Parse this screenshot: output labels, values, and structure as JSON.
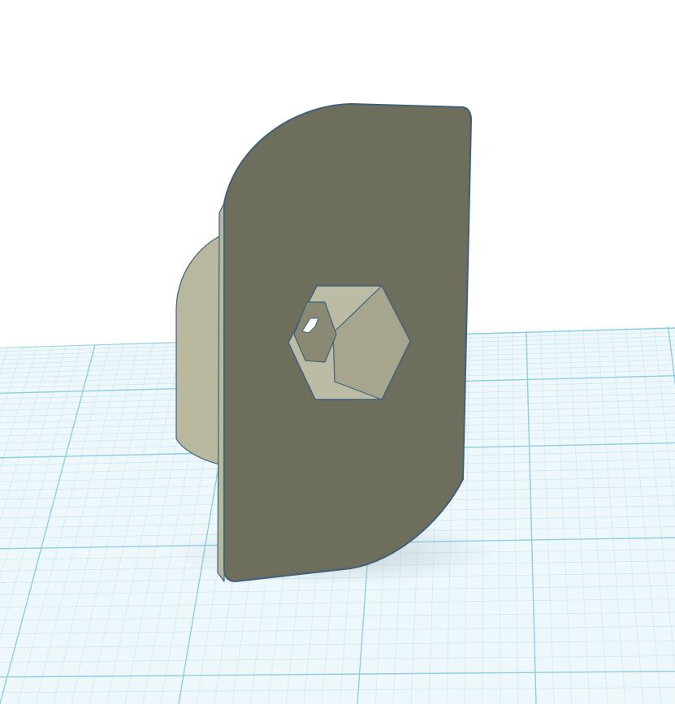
{
  "app": {
    "view": "3d-workplane"
  },
  "scene": {
    "background_color": "#ffffff",
    "workplane": {
      "fill_color": "#eef8fb",
      "minor_grid_color": "#cfe8f1",
      "major_grid_color": "#8fcde0",
      "grid_visible": true
    },
    "object": {
      "shape": "bracket-plate-with-hex-nut-pocket",
      "front_face_color": "#6e6e5d",
      "side_face_color": "#b8b89e",
      "outline_color": "#3f5f7a",
      "hex_pocket_color": "#bcbca4"
    }
  }
}
